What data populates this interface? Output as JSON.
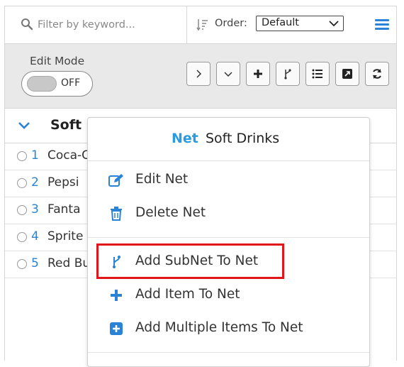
{
  "search": {
    "placeholder": "Filter by keyword..."
  },
  "order": {
    "label": "Order:",
    "selected": "Default"
  },
  "toolbar": {
    "edit_mode_label": "Edit Mode",
    "toggle_state": "OFF",
    "buttons": [
      {
        "icon": "chevron-right-icon",
        "glyph": "›"
      },
      {
        "icon": "chevron-down-icon",
        "glyph": "⌄"
      },
      {
        "icon": "plus-icon",
        "glyph": "✚"
      },
      {
        "icon": "branch-icon",
        "glyph": "⑂"
      },
      {
        "icon": "list-icon",
        "glyph": "☰"
      },
      {
        "icon": "expand-image-icon",
        "glyph": "◳"
      },
      {
        "icon": "refresh-icon",
        "glyph": "↻"
      }
    ]
  },
  "group": {
    "title": "Soft D"
  },
  "items": [
    {
      "num": "1",
      "name": "Coca-C"
    },
    {
      "num": "2",
      "name": "Pepsi"
    },
    {
      "num": "3",
      "name": "Fanta"
    },
    {
      "num": "4",
      "name": "Sprite"
    },
    {
      "num": "5",
      "name": "Red Bu"
    }
  ],
  "context_menu": {
    "tag": "Net",
    "title": "Soft Drinks",
    "items": [
      {
        "label": "Edit Net",
        "icon": "edit-icon"
      },
      {
        "label": "Delete Net",
        "icon": "trash-icon"
      },
      {
        "label": "Add SubNet To Net",
        "icon": "branch-icon"
      },
      {
        "label": "Add Item To Net",
        "icon": "plus-icon"
      },
      {
        "label": "Add Multiple Items To Net",
        "icon": "plus-square-icon"
      }
    ]
  },
  "colors": {
    "accent": "#2a83d6",
    "tag": "#2a9be0",
    "highlight": "#e0161b"
  }
}
